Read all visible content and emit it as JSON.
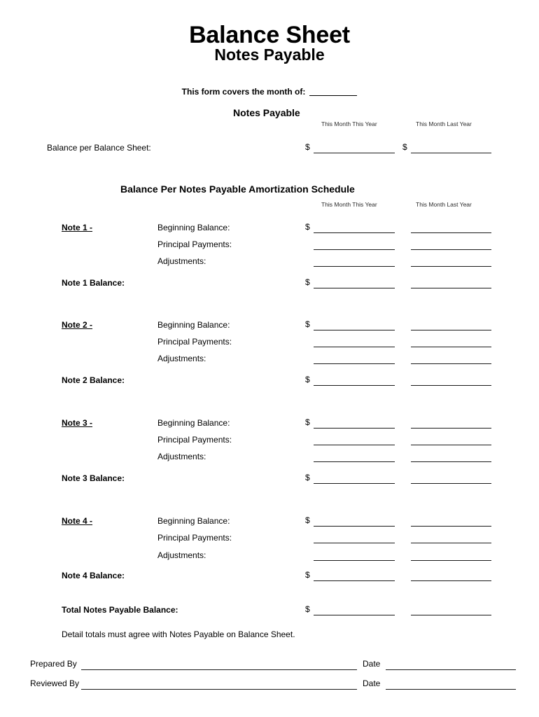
{
  "document": {
    "title_main": "Balance Sheet",
    "title_sub": "Notes Payable",
    "month_line_label": "This form covers the month of:",
    "section_notes_payable_heading": "Notes Payable",
    "section_amortization_heading": "Balance Per Notes Payable Amortization Schedule",
    "column_headers": {
      "this_year": "This Month This Year",
      "last_year": "This Month Last Year"
    },
    "currency_symbol": "$"
  },
  "balance_per_balance_sheet": {
    "label": "Balance per Balance Sheet:"
  },
  "notes": [
    {
      "title": "Note 1 -",
      "rows": [
        {
          "label": "Beginning Balance:"
        },
        {
          "label": "Principal Payments:"
        },
        {
          "label": "Adjustments:"
        }
      ],
      "balance_label": "Note 1 Balance:"
    },
    {
      "title": "Note 2 -",
      "rows": [
        {
          "label": "Beginning Balance:"
        },
        {
          "label": "Principal Payments:"
        },
        {
          "label": "Adjustments:"
        }
      ],
      "balance_label": "Note 2 Balance:"
    },
    {
      "title": "Note 3 -",
      "rows": [
        {
          "label": "Beginning Balance:"
        },
        {
          "label": "Principal Payments:"
        },
        {
          "label": "Adjustments:"
        }
      ],
      "balance_label": "Note 3 Balance:"
    },
    {
      "title": "Note 4 -",
      "rows": [
        {
          "label": "Beginning Balance:"
        },
        {
          "label": "Principal Payments:"
        },
        {
          "label": "Adjustments:"
        }
      ],
      "balance_label": "Note 4 Balance:"
    }
  ],
  "total": {
    "label": "Total Notes Payable Balance:",
    "note": "Detail totals must agree with Notes Payable on Balance Sheet."
  },
  "footer": {
    "prepared_by_label": "Prepared By",
    "reviewed_by_label": "Reviewed By",
    "date_label_1": "Date",
    "date_label_2": "Date"
  }
}
